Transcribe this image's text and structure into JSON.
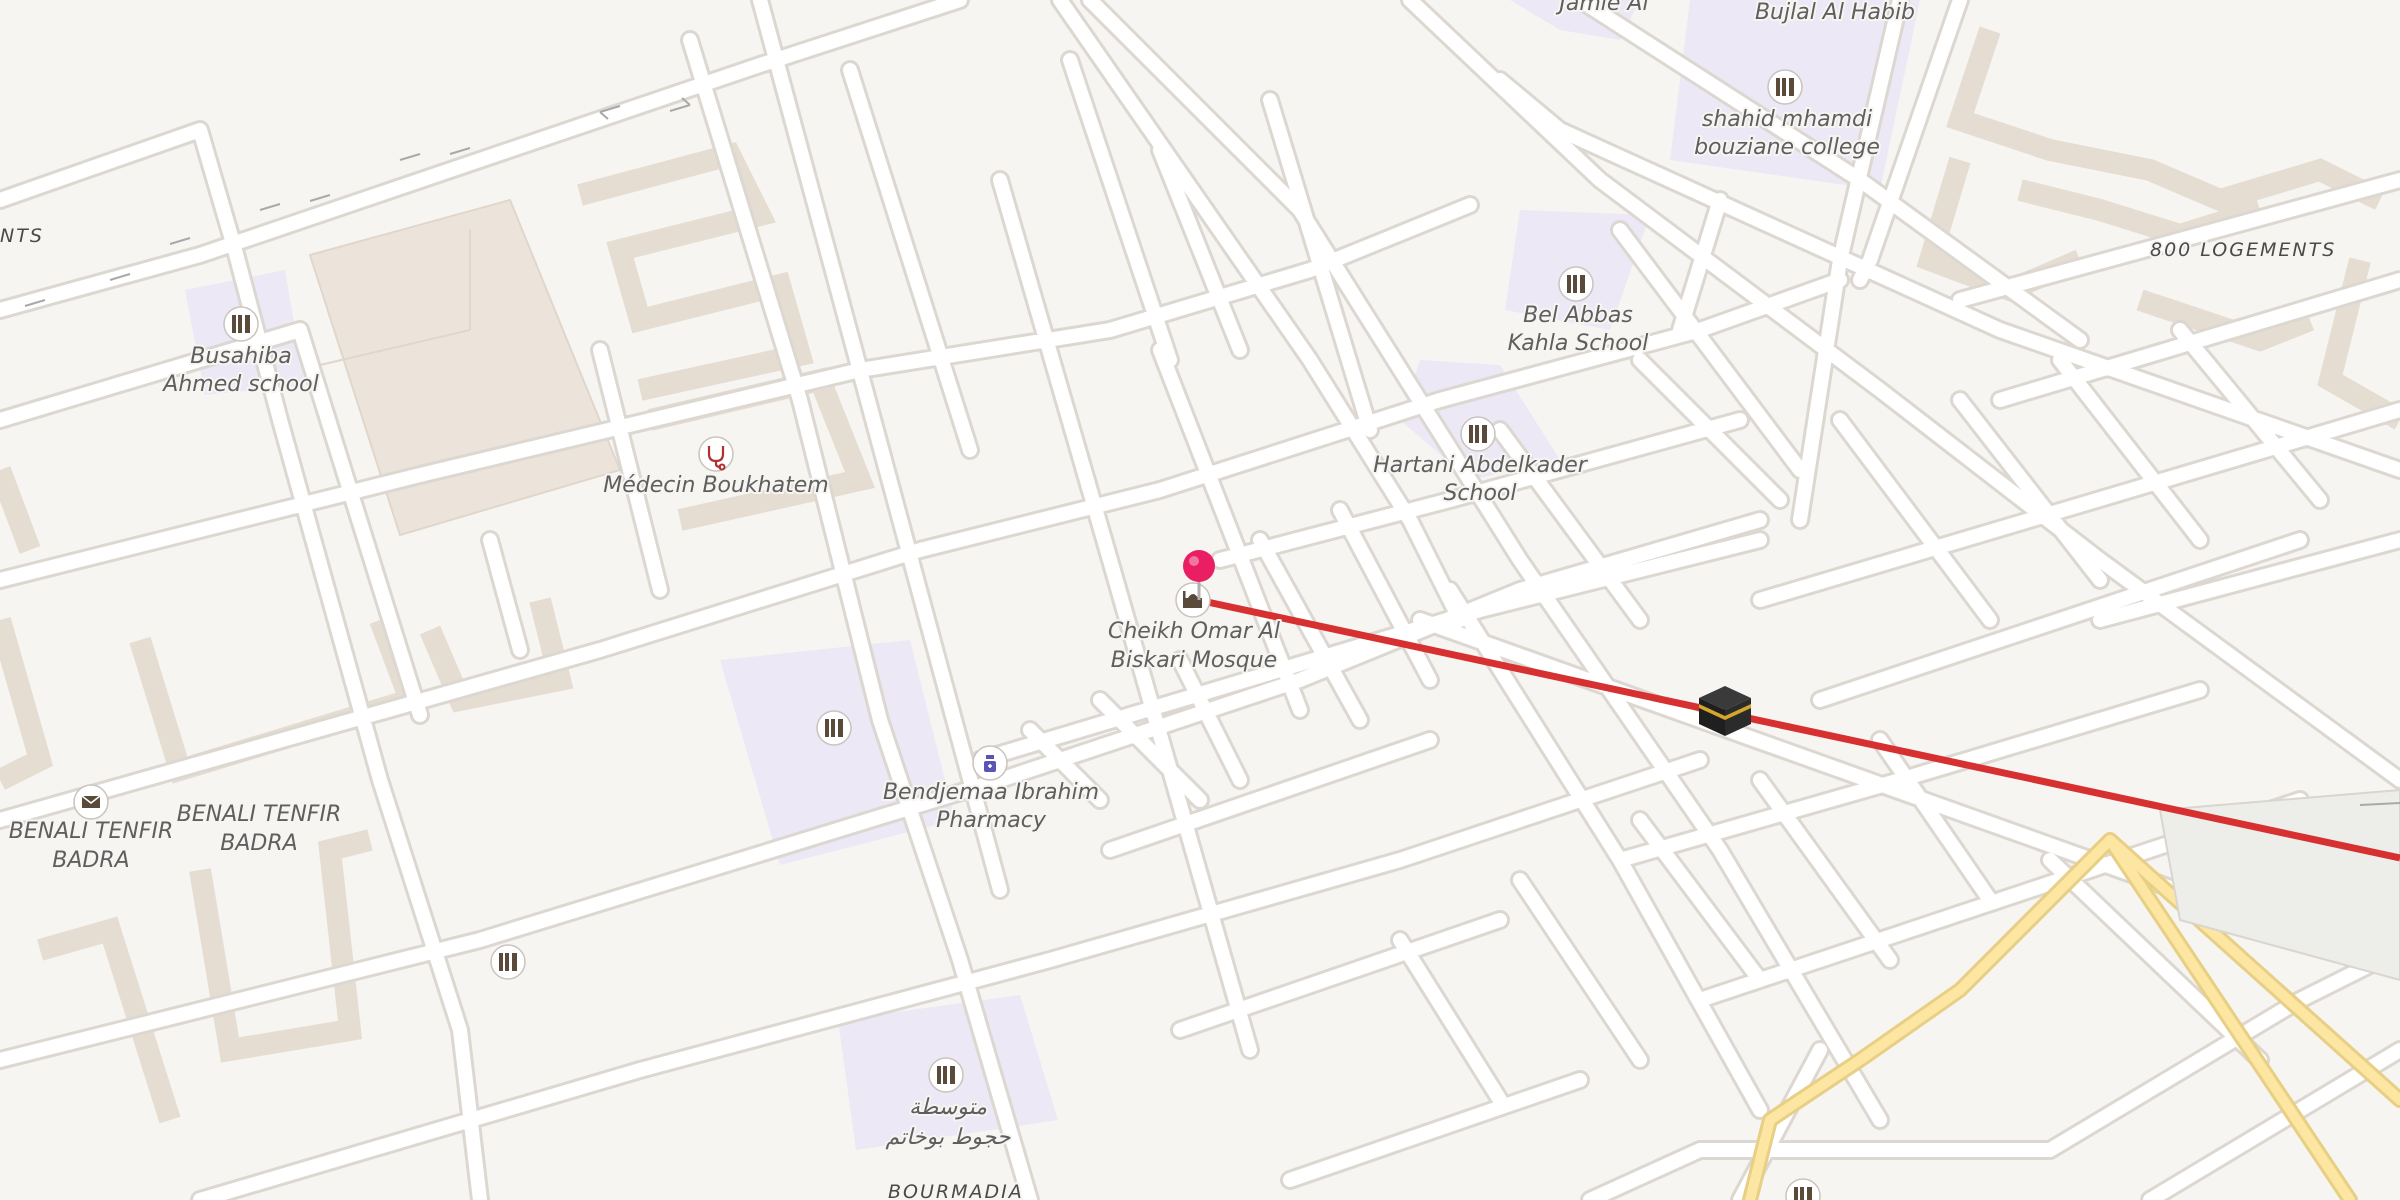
{
  "map": {
    "areas": {
      "ents": "NTS",
      "logements": "800 LOGEMENTS",
      "bourmadia": "BOURMADIA"
    },
    "pois": [
      {
        "name": "Jamie Al",
        "icon": "school-icon"
      },
      {
        "name": "Bujlal Al Habib",
        "icon": "school-icon"
      },
      {
        "name": "shahid mhamdi",
        "name2": "bouziane college",
        "icon": "school-icon"
      },
      {
        "name": "Busahiba",
        "name2": "Ahmed school",
        "icon": "school-icon"
      },
      {
        "name": "Bel Abbas",
        "name2": "Kahla School",
        "icon": "school-icon"
      },
      {
        "name": "Hartani Abdelkader",
        "name2": "School",
        "icon": "school-icon"
      },
      {
        "name": "Médecin Boukhatem",
        "icon": "doctor-icon"
      },
      {
        "name": "Cheikh Omar Al",
        "name2": "Biskari Mosque",
        "icon": "mosque-icon"
      },
      {
        "name": "Bendjemaa Ibrahim",
        "name2": "Pharmacy",
        "icon": "pharmacy-icon"
      },
      {
        "name": "BENALI TENFIR",
        "name2": "BADRA",
        "icon": "post-office-icon"
      },
      {
        "name": "BENALI TENFIR",
        "name2": "BADRA",
        "icon": "none"
      },
      {
        "name": "متوسطة",
        "name2": "حجوط بوخاتم",
        "icon": "school-icon"
      }
    ],
    "route": {
      "color": "#d63031",
      "direction": "qibla-line",
      "icon": "kaaba-icon"
    },
    "pin": {
      "color": "#e91e63",
      "icon": "location-pin-icon"
    },
    "colors": {
      "background": "#f7f5f2",
      "road": "#ffffff",
      "road_casing": "#d9d5cf",
      "major_road": "#fde6a2",
      "school_area": "#ece8f5",
      "building": "#ebe4dc"
    }
  }
}
